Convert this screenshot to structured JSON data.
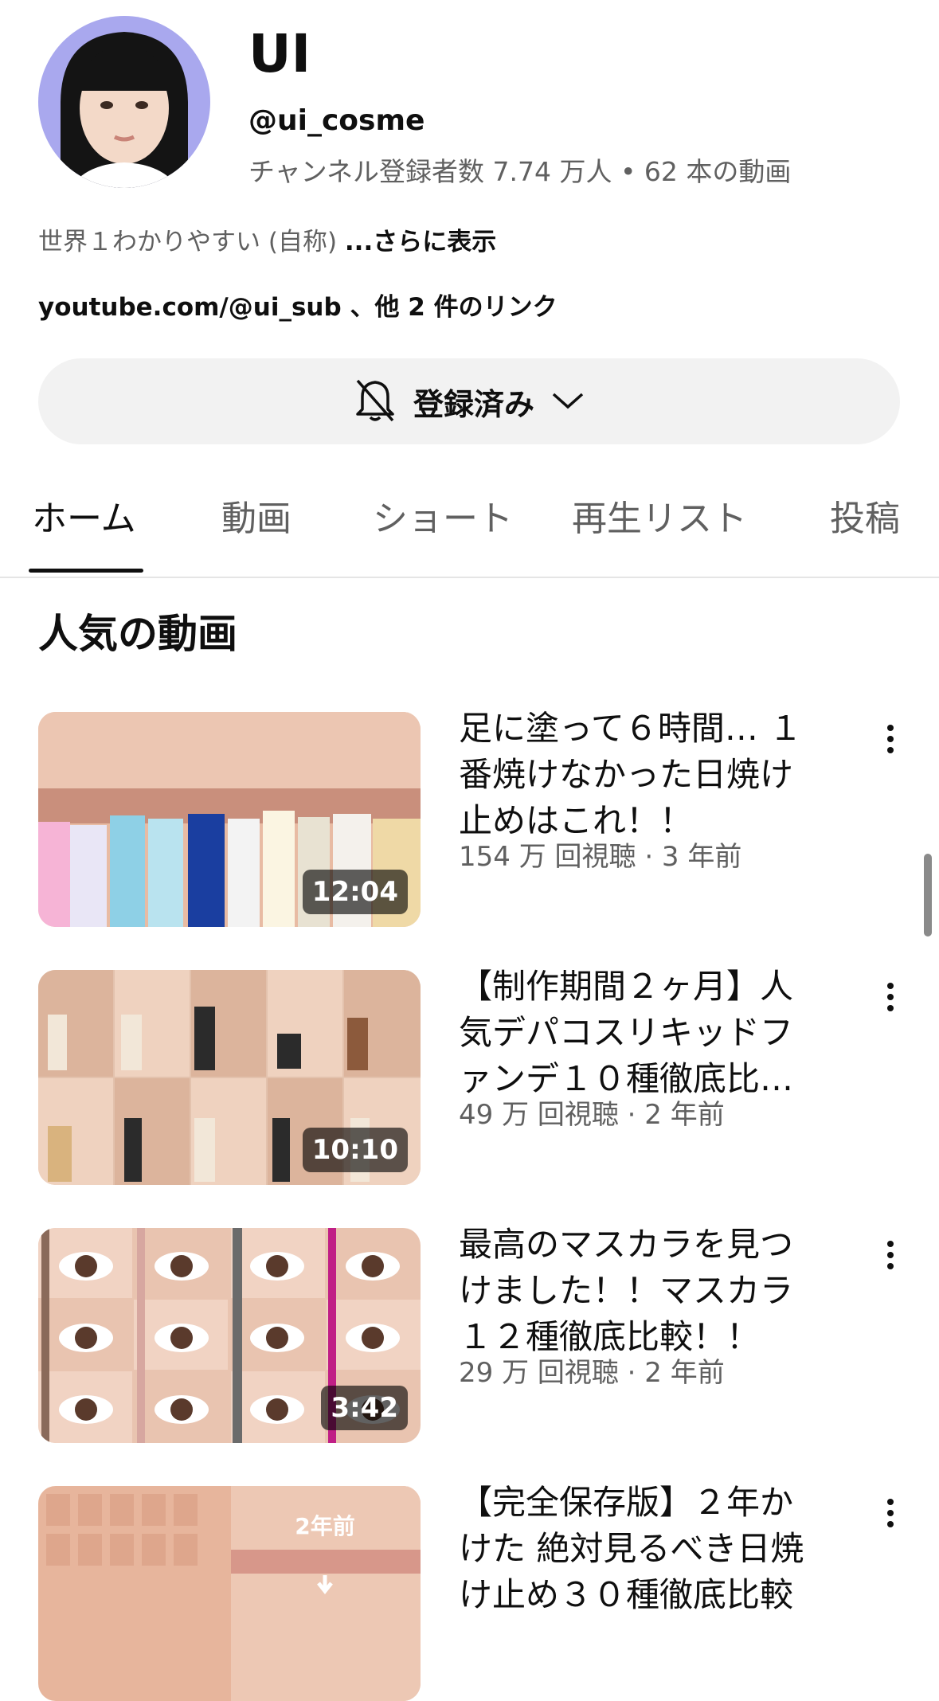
{
  "channel": {
    "name": "UI",
    "handle": "@ui_cosme",
    "stats": "チャンネル登録者数 7.74 万人 • 62 本の動画",
    "description": "世界１わかりやすい (自称)",
    "description_more": "...さらに表示",
    "links": "youtube.com/@ui_sub 、他 2 件のリンク"
  },
  "subscribe": {
    "label": "登録済み",
    "bell_icon": "bell-off-icon",
    "chevron_icon": "chevron-down-icon"
  },
  "tabs": [
    {
      "label": "ホーム",
      "active": true
    },
    {
      "label": "動画"
    },
    {
      "label": "ショート"
    },
    {
      "label": "再生リスト"
    },
    {
      "label": "投稿"
    }
  ],
  "section_title": "人気の動画",
  "videos": [
    {
      "title": "足に塗って６時間… １番焼けなかった日焼け止めはこれ！！",
      "meta": "154 万 回視聴 · 3 年前",
      "duration": "12:04"
    },
    {
      "title": "【制作期間２ヶ月】人気デパコスリキッドファンデ１０種徹底比較…",
      "meta": "49 万 回視聴 · 2 年前",
      "duration": "10:10"
    },
    {
      "title": "最高のマスカラを見つけました！！マスカラ１２種徹底比較！！",
      "meta": "29 万 回視聴 · 2 年前",
      "duration": "3:42"
    },
    {
      "title": "【完全保存版】２年かけた 絶対見るべき日焼け止め３０種徹底比較",
      "meta": "",
      "duration": "",
      "thumb_text": "2年前"
    }
  ],
  "colors": {
    "text_primary": "#0f0f0f",
    "text_secondary": "#606060",
    "button_bg": "#f2f2f2"
  }
}
